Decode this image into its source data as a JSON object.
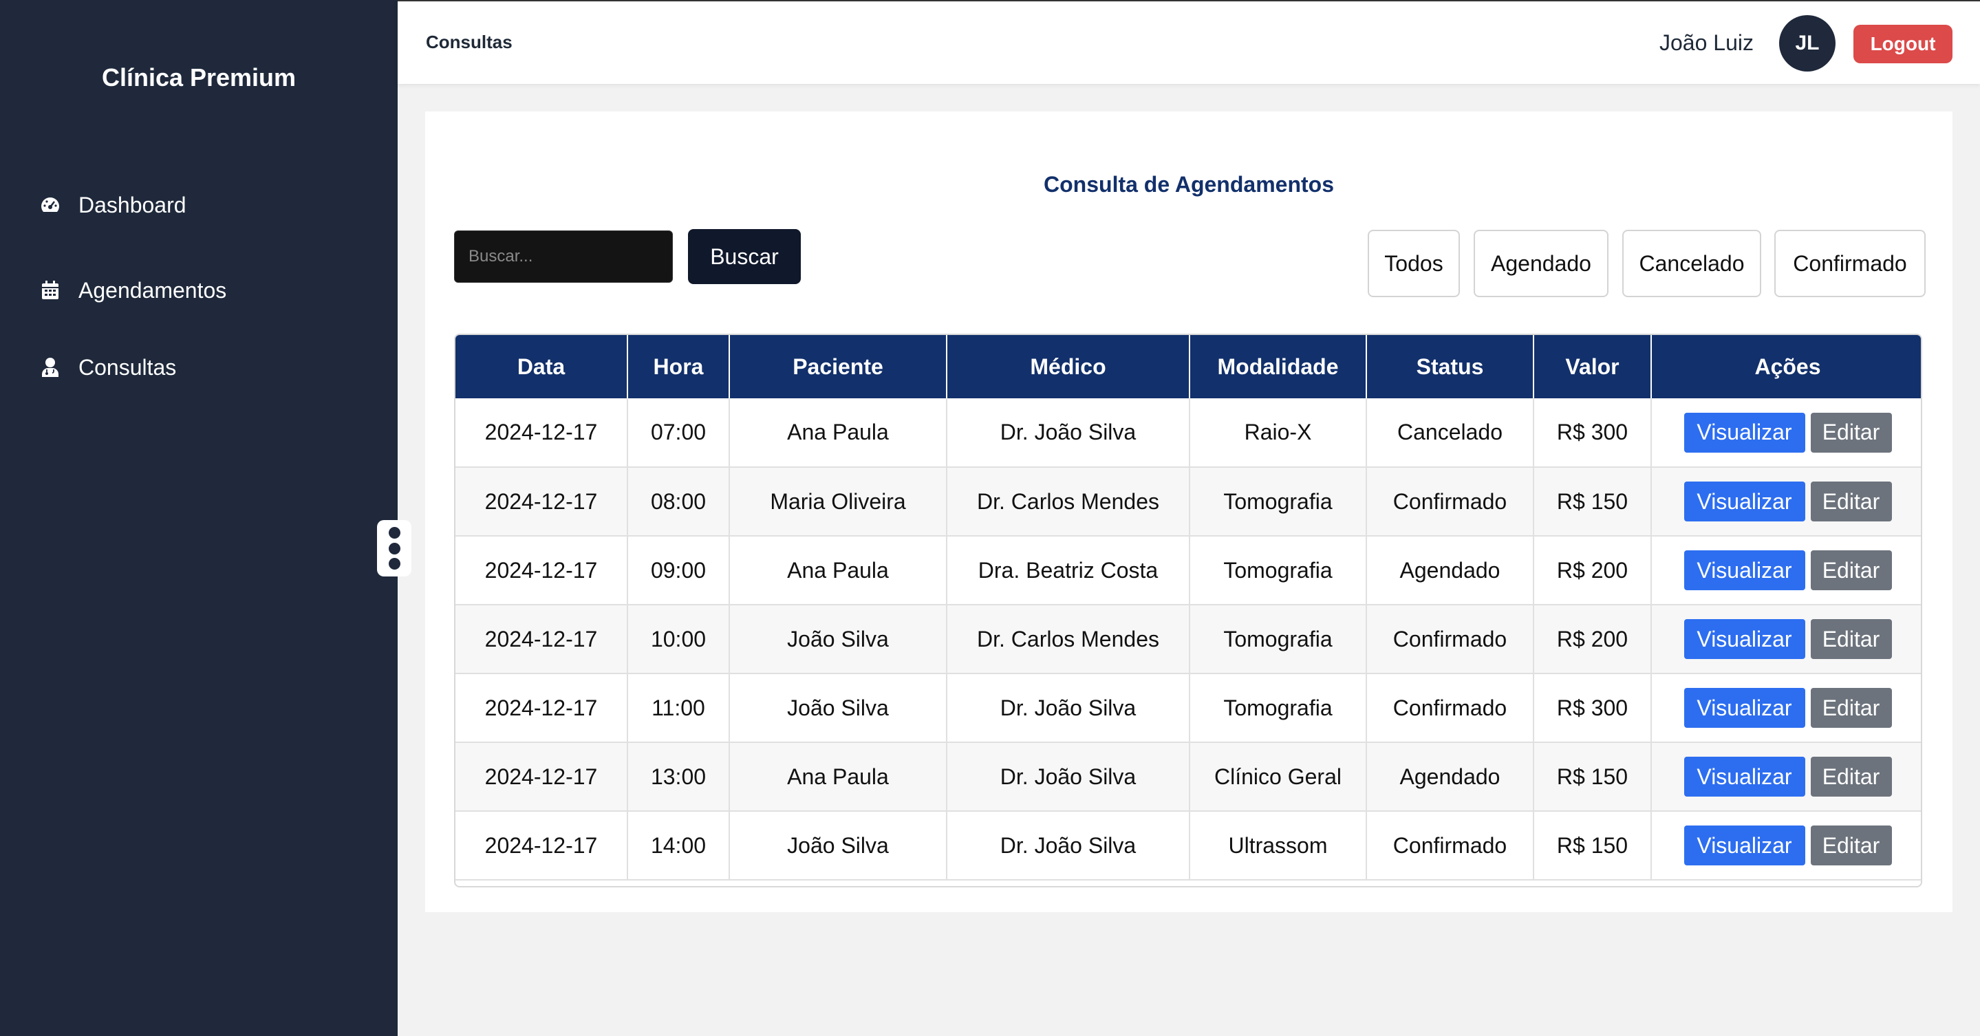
{
  "sidebar": {
    "brand": "Clínica Premium",
    "items": [
      {
        "label": "Dashboard",
        "icon": "gauge-icon"
      },
      {
        "label": "Agendamentos",
        "icon": "calendar-icon"
      },
      {
        "label": "Consultas",
        "icon": "doctor-icon"
      }
    ]
  },
  "header": {
    "breadcrumb": "Consultas",
    "user_name": "João Luiz",
    "avatar_initials": "JL",
    "logout_label": "Logout"
  },
  "main": {
    "title": "Consulta de Agendamentos",
    "search": {
      "placeholder": "Buscar...",
      "value": "",
      "button_label": "Buscar"
    },
    "filters": [
      "Todos",
      "Agendado",
      "Cancelado",
      "Confirmado"
    ],
    "table": {
      "columns": [
        "Data",
        "Hora",
        "Paciente",
        "Médico",
        "Modalidade",
        "Status",
        "Valor",
        "Ações"
      ],
      "rows": [
        [
          "2024-12-17",
          "07:00",
          "Ana Paula",
          "Dr. João Silva",
          "Raio-X",
          "Cancelado",
          "R$ 300"
        ],
        [
          "2024-12-17",
          "08:00",
          "Maria Oliveira",
          "Dr. Carlos Mendes",
          "Tomografia",
          "Confirmado",
          "R$ 150"
        ],
        [
          "2024-12-17",
          "09:00",
          "Ana Paula",
          "Dra. Beatriz Costa",
          "Tomografia",
          "Agendado",
          "R$ 200"
        ],
        [
          "2024-12-17",
          "10:00",
          "João Silva",
          "Dr. Carlos Mendes",
          "Tomografia",
          "Confirmado",
          "R$ 200"
        ],
        [
          "2024-12-17",
          "11:00",
          "João Silva",
          "Dr. João Silva",
          "Tomografia",
          "Confirmado",
          "R$ 300"
        ],
        [
          "2024-12-17",
          "13:00",
          "Ana Paula",
          "Dr. João Silva",
          "Clínico Geral",
          "Agendado",
          "R$ 150"
        ],
        [
          "2024-12-17",
          "14:00",
          "João Silva",
          "Dr. João Silva",
          "Ultrassom",
          "Confirmado",
          "R$ 150"
        ]
      ],
      "action_view": "Visualizar",
      "action_edit": "Editar"
    }
  },
  "colors": {
    "sidebar_bg": "#1f293b",
    "header_accent": "#12306b",
    "logout": "#dc4a4a",
    "view_button": "#2d6ef0",
    "edit_button": "#6c737c"
  }
}
